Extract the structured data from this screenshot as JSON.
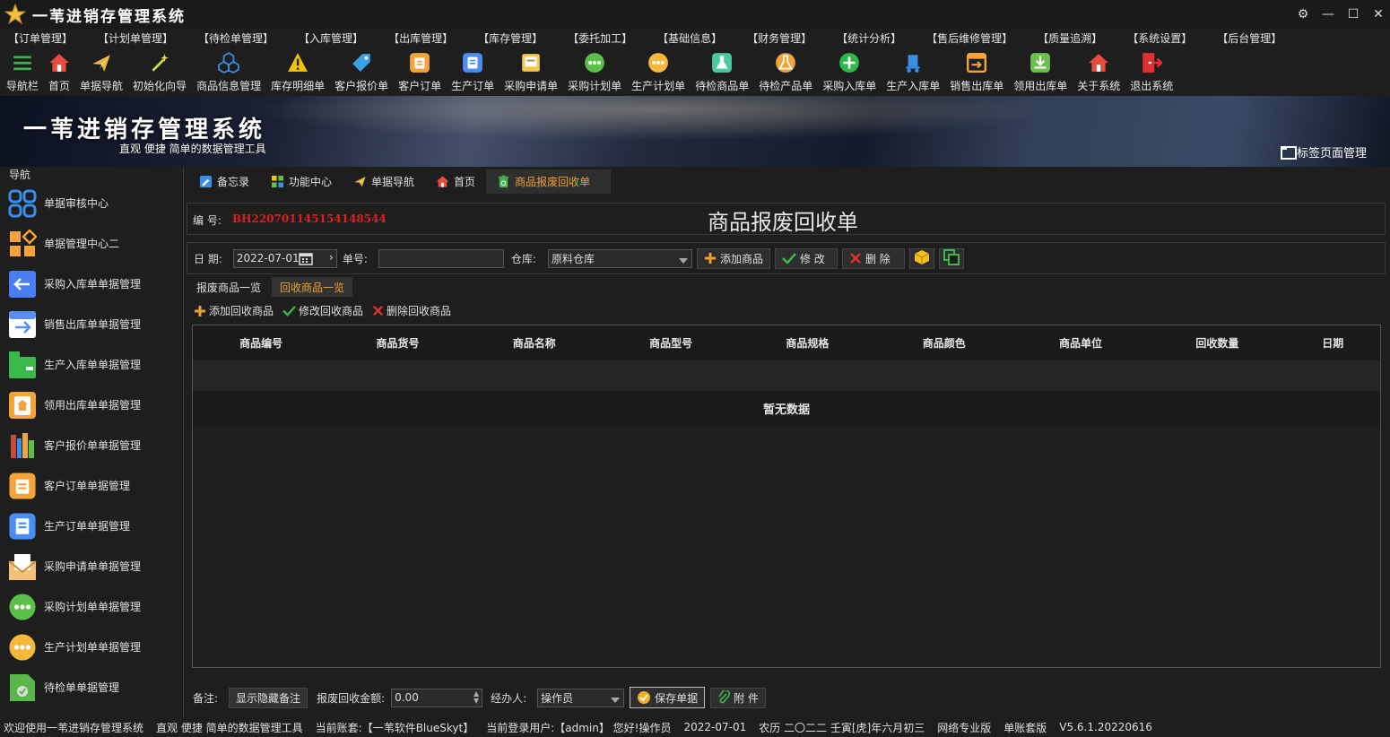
{
  "app": {
    "title": "一苇进销存管理系统"
  },
  "menu": [
    "【订单管理】",
    "【计划单管理】",
    "【待检单管理】",
    "【入库管理】",
    "【出库管理】",
    "【库存管理】",
    "【委托加工】",
    "【基础信息】",
    "【财务管理】",
    "【统计分析】",
    "【售后维修管理】",
    "【质量追溯】",
    "【系统设置】",
    "【后台管理】"
  ],
  "toolbar": [
    {
      "label": "导航栏",
      "icon": "menu-lines-icon",
      "color": "#3bb34a"
    },
    {
      "label": "首页",
      "icon": "home-icon",
      "color": "#e84c3d"
    },
    {
      "label": "单据导航",
      "icon": "plane-icon",
      "color": "#e8b83a"
    },
    {
      "label": "初始化向导",
      "icon": "magic-wand-icon",
      "color": "#c8d84a"
    },
    {
      "label": "商品信息管理",
      "icon": "cubes-icon",
      "color": "#3a8ee8"
    },
    {
      "label": "库存明细单",
      "icon": "warning-icon",
      "color": "#f2c300"
    },
    {
      "label": "客户报价单",
      "icon": "tag-icon",
      "color": "#3aa2e8"
    },
    {
      "label": "客户订单",
      "icon": "order-icon",
      "color": "#f4a23a"
    },
    {
      "label": "生产订单",
      "icon": "doc-icon",
      "color": "#4a8ef4"
    },
    {
      "label": "采购申请单",
      "icon": "request-icon",
      "color": "#f4c84a"
    },
    {
      "label": "采购计划单",
      "icon": "dots-icon",
      "color": "#5ac04a"
    },
    {
      "label": "生产计划单",
      "icon": "dots-icon",
      "color": "#f4b83a"
    },
    {
      "label": "待检商品单",
      "icon": "flask-icon",
      "color": "#4ac8a0"
    },
    {
      "label": "待检产品单",
      "icon": "lab-icon",
      "color": "#f4a23a"
    },
    {
      "label": "采购入库单",
      "icon": "plus-circle-icon",
      "color": "#2db84a"
    },
    {
      "label": "生产入库单",
      "icon": "cart-icon",
      "color": "#3a8ee8"
    },
    {
      "label": "销售出库单",
      "icon": "export-icon",
      "color": "#f4a23a"
    },
    {
      "label": "领用出库单",
      "icon": "download-icon",
      "color": "#6ac04a"
    },
    {
      "label": "关于系统",
      "icon": "house-icon",
      "color": "#e84c3d"
    },
    {
      "label": "退出系统",
      "icon": "exit-icon",
      "color": "#e03030"
    }
  ],
  "banner": {
    "title": "一苇进销存管理系统",
    "subtitle": "直观 便捷 简单的数据管理工具",
    "tag_manager": "标签页面管理"
  },
  "sidebar": {
    "header": "导航",
    "items": [
      {
        "label": "单据审核中心",
        "icon": "grid-icon",
        "color": "#3a8ee8"
      },
      {
        "label": "单据管理中心二",
        "icon": "blocks-icon",
        "color": "#f4a23a"
      },
      {
        "label": "采购入库单单据管理",
        "icon": "arrow-left-icon",
        "color": "#4a7ef4"
      },
      {
        "label": "销售出库单单据管理",
        "icon": "arrow-right-icon",
        "color": "#5a8ef4"
      },
      {
        "label": "生产入库单单据管理",
        "icon": "box-icon",
        "color": "#3ab84a"
      },
      {
        "label": "领用出库单单据管理",
        "icon": "clipboard-icon",
        "color": "#f4a23a"
      },
      {
        "label": "客户报价单单据管理",
        "icon": "books-icon",
        "color": "#c84a3a"
      },
      {
        "label": "客户订单单据管理",
        "icon": "order-icon",
        "color": "#f4a23a"
      },
      {
        "label": "生产订单单据管理",
        "icon": "doc-icon",
        "color": "#4a8ef4"
      },
      {
        "label": "采购申请单单据管理",
        "icon": "mail-icon",
        "color": "#f4c07a"
      },
      {
        "label": "采购计划单单据管理",
        "icon": "dots-icon",
        "color": "#5ac04a"
      },
      {
        "label": "生产计划单单据管理",
        "icon": "dots-icon",
        "color": "#f4b83a"
      },
      {
        "label": "待检单单据管理",
        "icon": "check-doc-icon",
        "color": "#5ab84a"
      }
    ]
  },
  "tabs": [
    {
      "label": "备忘录",
      "icon": "memo-icon",
      "color": "#3a8ee8",
      "active": false
    },
    {
      "label": "功能中心",
      "icon": "apps-icon",
      "color": "#5ac04a",
      "active": false
    },
    {
      "label": "单据导航",
      "icon": "plane-icon",
      "color": "#e8b83a",
      "active": false
    },
    {
      "label": "首页",
      "icon": "home-icon",
      "color": "#e84c3d",
      "active": false
    },
    {
      "label": "商品报废回收单",
      "icon": "recycle-icon",
      "color": "#3ab84a",
      "active": true
    }
  ],
  "form": {
    "code_label": "编 号:",
    "code_value": "BH220701145154148544",
    "title": "商品报废回收单",
    "date_label": "日 期:",
    "date_value": "2022-07-01",
    "number_label": "单号:",
    "number_value": "",
    "warehouse_label": "仓库:",
    "warehouse_value": "原料仓库",
    "add_goods": "添加商品",
    "modify": "修 改",
    "delete": "删 除"
  },
  "subtabs": [
    {
      "label": "报废商品一览",
      "active": false
    },
    {
      "label": "回收商品一览",
      "active": true
    }
  ],
  "actions": {
    "add": "添加回收商品",
    "edit": "修改回收商品",
    "remove": "删除回收商品"
  },
  "grid": {
    "columns": [
      "商品编号",
      "商品货号",
      "商品名称",
      "商品型号",
      "商品规格",
      "商品颜色",
      "商品单位",
      "回收数量",
      "日期"
    ],
    "empty_text": "暂无数据"
  },
  "bottom": {
    "remark_label": "备注:",
    "toggle_remark": "显示隐藏备注",
    "amount_label": "报废回收金额:",
    "amount_value": "0.00",
    "handler_label": "经办人:",
    "handler_value": "操作员",
    "save": "保存单据",
    "attach": "附 件"
  },
  "status": [
    "欢迎使用一苇进销存管理系统",
    "直观 便捷 简单的数据管理工具",
    "当前账套:【一苇软件BlueSkyt】",
    "当前登录用户:【admin】 您好!操作员",
    "2022-07-01",
    "农历 二〇二二 壬寅[虎]年六月初三",
    "网络专业版",
    "单账套版",
    "V5.6.1.20220616"
  ]
}
